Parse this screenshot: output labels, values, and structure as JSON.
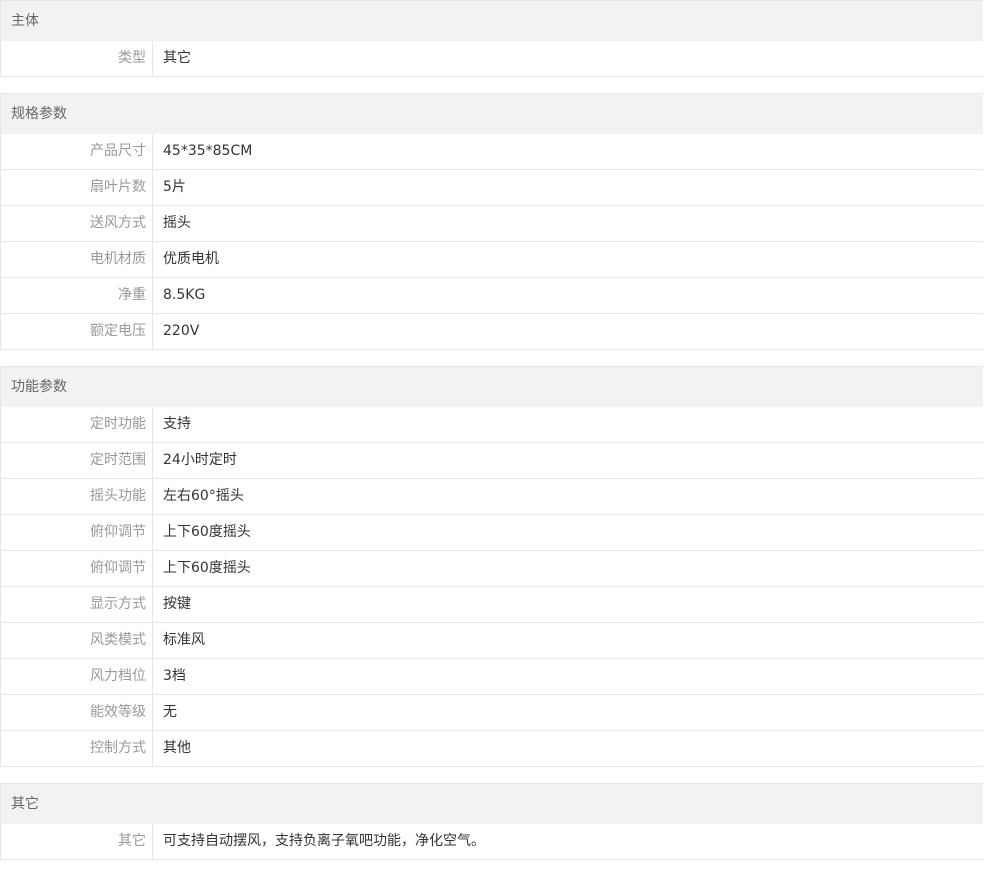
{
  "sections": [
    {
      "title": "主体",
      "rows": [
        {
          "label": "类型",
          "value": "其它"
        }
      ]
    },
    {
      "title": "规格参数",
      "rows": [
        {
          "label": "产品尺寸",
          "value": "45*35*85CM"
        },
        {
          "label": "扇叶片数",
          "value": "5片"
        },
        {
          "label": "送风方式",
          "value": "摇头"
        },
        {
          "label": "电机材质",
          "value": "优质电机"
        },
        {
          "label": "净重",
          "value": "8.5KG"
        },
        {
          "label": "额定电压",
          "value": "220V"
        }
      ]
    },
    {
      "title": "功能参数",
      "rows": [
        {
          "label": "定时功能",
          "value": "支持"
        },
        {
          "label": "定时范围",
          "value": "24小时定时"
        },
        {
          "label": "摇头功能",
          "value": "左右60°摇头"
        },
        {
          "label": "俯仰调节",
          "value": "上下60度摇头"
        },
        {
          "label": "俯仰调节",
          "value": "上下60度摇头"
        },
        {
          "label": "显示方式",
          "value": "按键"
        },
        {
          "label": "风类模式",
          "value": "标准风"
        },
        {
          "label": "风力档位",
          "value": "3档"
        },
        {
          "label": "能效等级",
          "value": "无"
        },
        {
          "label": "控制方式",
          "value": "其他"
        }
      ]
    },
    {
      "title": "其它",
      "rows": [
        {
          "label": "其它",
          "value": "可支持自动摆风，支持负离子氧吧功能，净化空气。"
        }
      ]
    }
  ]
}
